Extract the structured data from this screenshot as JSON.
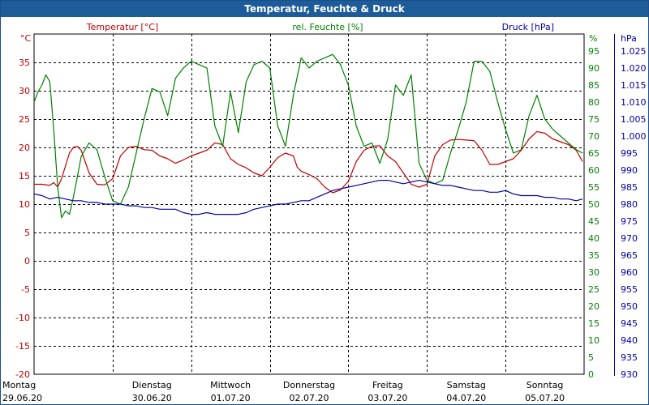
{
  "window": {
    "title": "Temperatur, Feuchte & Druck"
  },
  "colors": {
    "title_bar": "#1d5c99",
    "temperature": "#c00000",
    "humidity": "#008000",
    "pressure": "#0000a0",
    "grid": "#000000"
  },
  "chart_data": {
    "type": "line",
    "title": "Temperatur, Feuchte & Druck",
    "legend_labels": {
      "temperature": "Temperatur [°C]",
      "humidity": "rel. Feuchte [%]",
      "pressure": "Druck [hPa]"
    },
    "axes": {
      "left": {
        "unit": "°C",
        "range": [
          -20,
          40
        ],
        "ticks": [
          -20,
          -15,
          -10,
          -5,
          0,
          5,
          10,
          15,
          20,
          25,
          30,
          35
        ],
        "tick_labels": [
          "-20",
          "-15",
          "-10",
          "-5",
          "0",
          "5",
          "10",
          "15",
          "20",
          "25",
          "30",
          "35"
        ]
      },
      "right_humidity": {
        "unit": "%",
        "range": [
          0,
          100
        ],
        "ticks": [
          0,
          5,
          10,
          15,
          20,
          25,
          30,
          35,
          40,
          45,
          50,
          55,
          60,
          65,
          70,
          75,
          80,
          85,
          90,
          95
        ],
        "tick_labels": [
          "0",
          "5",
          "10",
          "15",
          "20",
          "25",
          "30",
          "35",
          "40",
          "45",
          "50",
          "55",
          "60",
          "65",
          "70",
          "75",
          "80",
          "85",
          "90",
          "95"
        ]
      },
      "right_pressure": {
        "unit": "hPa",
        "range": [
          930,
          1030
        ],
        "ticks": [
          930,
          935,
          940,
          945,
          950,
          955,
          960,
          965,
          970,
          975,
          980,
          985,
          990,
          995,
          1000,
          1005,
          1010,
          1015,
          1020,
          1025
        ],
        "tick_labels": [
          "930",
          "935",
          "940",
          "945",
          "950",
          "955",
          "960",
          "965",
          "970",
          "975",
          "980",
          "985",
          "990",
          "995",
          "1.000",
          "1.005",
          "1.010",
          "1.015",
          "1.020",
          "1.025"
        ]
      }
    },
    "x_range_days": [
      0,
      7
    ],
    "x_labels": [
      {
        "day": "Montag",
        "date": "29.06.20"
      },
      {
        "day": "Dienstag",
        "date": "30.06.20"
      },
      {
        "day": "Mittwoch",
        "date": "01.07.20"
      },
      {
        "day": "Donnerstag",
        "date": "02.07.20"
      },
      {
        "day": "Freitag",
        "date": "03.07.20"
      },
      {
        "day": "Samstag",
        "date": "04.07.20"
      },
      {
        "day": "Sonntag",
        "date": "05.07.20"
      }
    ],
    "grid": true,
    "series": [
      {
        "name": "Temperatur [°C]",
        "axis": "left",
        "x": [
          0,
          0.1,
          0.2,
          0.25,
          0.3,
          0.35,
          0.45,
          0.5,
          0.55,
          0.6,
          0.7,
          0.8,
          0.9,
          1,
          1.1,
          1.2,
          1.3,
          1.4,
          1.5,
          1.6,
          1.7,
          1.8,
          1.9,
          2,
          2.1,
          2.2,
          2.3,
          2.4,
          2.5,
          2.6,
          2.7,
          2.8,
          2.9,
          3,
          3.1,
          3.2,
          3.3,
          3.35,
          3.4,
          3.5,
          3.6,
          3.7,
          3.8,
          3.9,
          4,
          4.1,
          4.2,
          4.3,
          4.4,
          4.5,
          4.6,
          4.7,
          4.8,
          4.9,
          5,
          5.1,
          5.2,
          5.3,
          5.4,
          5.5,
          5.6,
          5.7,
          5.8,
          5.9,
          6,
          6.1,
          6.2,
          6.3,
          6.4,
          6.5,
          6.6,
          6.7,
          6.8,
          6.9,
          6.98
        ],
        "values": [
          13.5,
          13.5,
          13.3,
          13.8,
          13,
          14.5,
          19,
          20,
          20.2,
          19.5,
          15.5,
          13.5,
          13.4,
          14.5,
          18.5,
          20,
          20.2,
          19.6,
          19.5,
          18.5,
          18,
          17.2,
          17.8,
          18.5,
          19,
          19.5,
          20.8,
          20.5,
          18,
          17,
          16.4,
          15.5,
          15,
          16.5,
          18.2,
          19,
          18.5,
          16.5,
          15.8,
          15.2,
          14.5,
          13,
          12,
          12.5,
          14,
          17.5,
          19.5,
          20.2,
          20.3,
          18.5,
          17.5,
          15.5,
          13.5,
          13,
          13.5,
          18.5,
          20.5,
          21.3,
          21.4,
          21.3,
          21.2,
          19.5,
          17,
          17,
          17.5,
          18,
          19.5,
          21.5,
          22.8,
          22.5,
          21.5,
          21,
          20.5,
          19.5,
          17.5
        ]
      },
      {
        "name": "rel. Feuchte [%]",
        "axis": "right_humidity",
        "x": [
          0,
          0.05,
          0.1,
          0.15,
          0.2,
          0.25,
          0.3,
          0.35,
          0.4,
          0.45,
          0.5,
          0.55,
          0.6,
          0.7,
          0.8,
          0.9,
          1,
          1.1,
          1.2,
          1.3,
          1.4,
          1.5,
          1.6,
          1.7,
          1.8,
          1.9,
          2,
          2.1,
          2.2,
          2.3,
          2.4,
          2.5,
          2.6,
          2.7,
          2.8,
          2.9,
          3,
          3.1,
          3.2,
          3.3,
          3.4,
          3.5,
          3.6,
          3.7,
          3.8,
          3.9,
          4,
          4.1,
          4.2,
          4.3,
          4.4,
          4.5,
          4.6,
          4.7,
          4.8,
          4.9,
          5,
          5.1,
          5.2,
          5.3,
          5.4,
          5.5,
          5.6,
          5.7,
          5.8,
          5.9,
          6,
          6.1,
          6.2,
          6.3,
          6.4,
          6.5,
          6.6,
          6.7,
          6.8,
          6.9,
          6.98
        ],
        "values": [
          80,
          83,
          85,
          88,
          86,
          72,
          55,
          46,
          48,
          47,
          52,
          58,
          64,
          68,
          66,
          58,
          51,
          50,
          55,
          65,
          75,
          84,
          83,
          76,
          87,
          90,
          92,
          91,
          90,
          73,
          67,
          83,
          71,
          86,
          91,
          92,
          90,
          73,
          67,
          82,
          93,
          90,
          92,
          93,
          94,
          91,
          85,
          73,
          67,
          68,
          62,
          69,
          85,
          82,
          88,
          62,
          57,
          56,
          57,
          65,
          72,
          80,
          92,
          92,
          89,
          80,
          72,
          65,
          66,
          76,
          82,
          75,
          72,
          70,
          68,
          66,
          65
        ]
      },
      {
        "name": "Druck [hPa]",
        "axis": "right_pressure",
        "x": [
          0,
          0.1,
          0.2,
          0.3,
          0.4,
          0.5,
          0.6,
          0.7,
          0.8,
          0.9,
          1,
          1.1,
          1.2,
          1.3,
          1.4,
          1.5,
          1.6,
          1.7,
          1.8,
          1.9,
          2,
          2.1,
          2.2,
          2.3,
          2.4,
          2.5,
          2.6,
          2.7,
          2.8,
          2.9,
          3,
          3.1,
          3.2,
          3.3,
          3.4,
          3.5,
          3.6,
          3.7,
          3.8,
          3.9,
          4,
          4.1,
          4.2,
          4.3,
          4.4,
          4.5,
          4.6,
          4.7,
          4.8,
          4.9,
          5,
          5.1,
          5.2,
          5.3,
          5.4,
          5.5,
          5.6,
          5.7,
          5.8,
          5.9,
          6,
          6.1,
          6.2,
          6.3,
          6.4,
          6.5,
          6.6,
          6.7,
          6.8,
          6.9,
          6.98
        ],
        "values": [
          983,
          982.5,
          981.5,
          982,
          981.5,
          981,
          981,
          980.5,
          980.5,
          980,
          980,
          980,
          979.5,
          979.5,
          979,
          979,
          978.5,
          978.5,
          978.5,
          977.5,
          977,
          977,
          977.5,
          977,
          977,
          977,
          977,
          977.5,
          978.5,
          979,
          979.5,
          980,
          980,
          980.5,
          981,
          981,
          982,
          983,
          984,
          984.5,
          985,
          985.5,
          986,
          986.5,
          987,
          987,
          986.5,
          986,
          986.5,
          987,
          986.5,
          986,
          985.5,
          985.5,
          985,
          984.5,
          984,
          984,
          983.5,
          983.5,
          984,
          983,
          982.5,
          982.5,
          982.5,
          982,
          982,
          981.5,
          981.5,
          981,
          981.5
        ]
      }
    ]
  }
}
